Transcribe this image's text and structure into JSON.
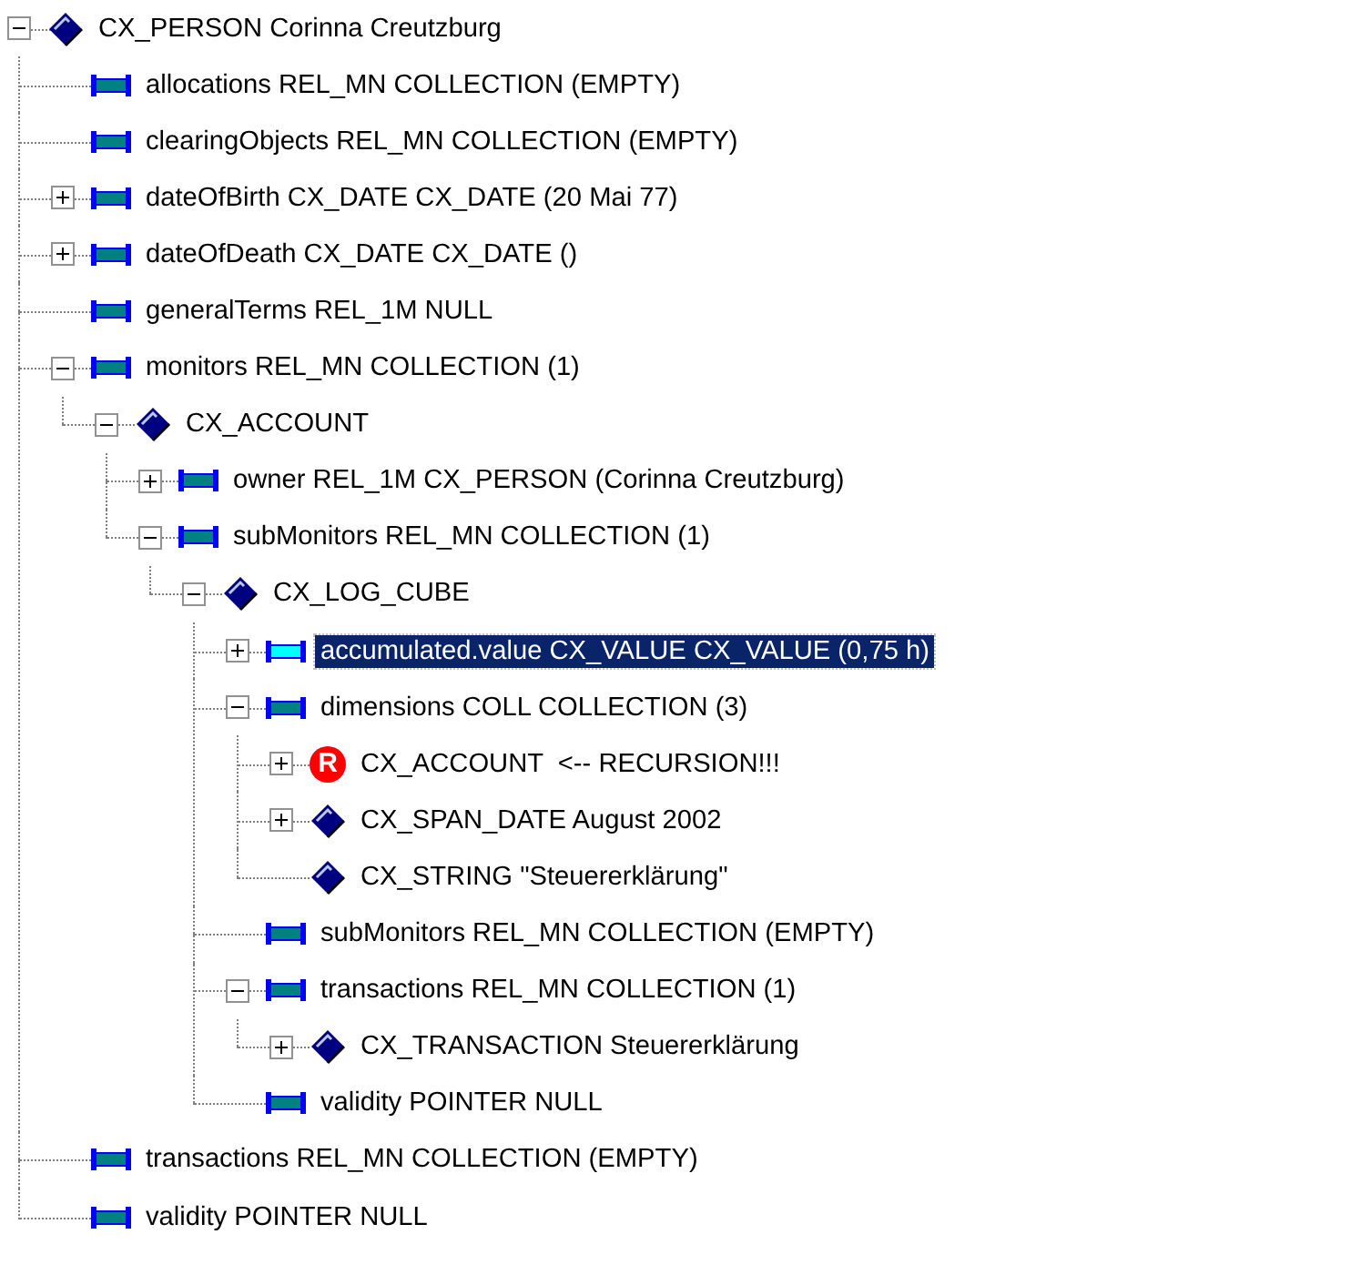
{
  "tree": {
    "nodes": [
      {
        "kind": "object",
        "label": "CX_PERSON Corinna Creutzburg",
        "expanded": true,
        "selected": false,
        "children": [
          {
            "kind": "attribute",
            "label": "allocations REL_MN COLLECTION (EMPTY)",
            "selected": false
          },
          {
            "kind": "attribute",
            "label": "clearingObjects REL_MN COLLECTION (EMPTY)",
            "selected": false
          },
          {
            "kind": "attribute",
            "label": "dateOfBirth CX_DATE CX_DATE (20 Mai 77)",
            "expanded": false,
            "selected": false
          },
          {
            "kind": "attribute",
            "label": "dateOfDeath CX_DATE CX_DATE ()",
            "expanded": false,
            "selected": false
          },
          {
            "kind": "attribute",
            "label": "generalTerms REL_1M NULL",
            "selected": false
          },
          {
            "kind": "attribute",
            "label": "monitors REL_MN COLLECTION (1)",
            "expanded": true,
            "selected": false,
            "children": [
              {
                "kind": "object",
                "label": "CX_ACCOUNT",
                "expanded": true,
                "selected": false,
                "children": [
                  {
                    "kind": "attribute",
                    "label": "owner REL_1M CX_PERSON (Corinna Creutzburg)",
                    "expanded": false,
                    "selected": false
                  },
                  {
                    "kind": "attribute",
                    "label": "subMonitors REL_MN COLLECTION (1)",
                    "expanded": true,
                    "selected": false,
                    "children": [
                      {
                        "kind": "object",
                        "label": "CX_LOG_CUBE",
                        "expanded": true,
                        "selected": false,
                        "children": [
                          {
                            "kind": "attribute",
                            "label": "accumulated.value CX_VALUE CX_VALUE (0,75 h)",
                            "expanded": false,
                            "selected": true
                          },
                          {
                            "kind": "attribute",
                            "label": "dimensions COLL COLLECTION (3)",
                            "expanded": true,
                            "selected": false,
                            "children": [
                              {
                                "kind": "recursion",
                                "badge": "R",
                                "label": "CX_ACCOUNT  <-- RECURSION!!!",
                                "expanded": false,
                                "selected": false
                              },
                              {
                                "kind": "object",
                                "label": "CX_SPAN_DATE August 2002",
                                "expanded": false,
                                "selected": false
                              },
                              {
                                "kind": "object",
                                "label": "CX_STRING \"Steuererklärung\"",
                                "selected": false
                              }
                            ]
                          },
                          {
                            "kind": "attribute",
                            "label": "subMonitors REL_MN COLLECTION (EMPTY)",
                            "selected": false
                          },
                          {
                            "kind": "attribute",
                            "label": "transactions REL_MN COLLECTION (1)",
                            "expanded": true,
                            "selected": false,
                            "children": [
                              {
                                "kind": "object",
                                "label": "CX_TRANSACTION Steuererklärung",
                                "expanded": false,
                                "selected": false
                              }
                            ]
                          },
                          {
                            "kind": "attribute",
                            "label": "validity POINTER NULL",
                            "selected": false
                          }
                        ]
                      }
                    ]
                  }
                ]
              }
            ]
          },
          {
            "kind": "attribute",
            "label": "transactions REL_MN COLLECTION (EMPTY)",
            "selected": false
          },
          {
            "kind": "attribute",
            "label": "validity POINTER NULL",
            "selected": false
          }
        ]
      }
    ]
  }
}
